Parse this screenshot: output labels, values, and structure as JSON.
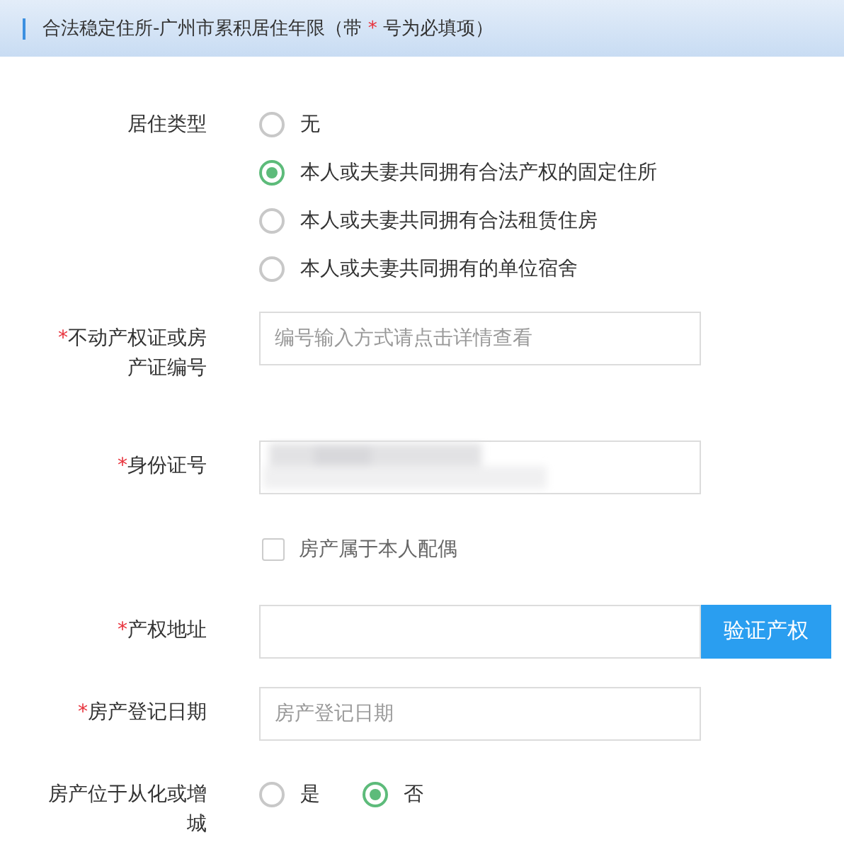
{
  "header": {
    "title_start": "合法稳定住所-广州市累积居住年限（带 ",
    "title_mark": "*",
    "title_end": " 号为必填项）"
  },
  "rows": [
    {
      "kind": "radio_group",
      "label": {
        "text": "居住类型"
      },
      "options": [
        {
          "label": "无",
          "selected": false
        },
        {
          "label": "本人或夫妻共同拥有合法产权的固定住所",
          "selected": true
        },
        {
          "label": "本人或夫妻共同拥有合法租赁住房",
          "selected": false
        },
        {
          "label": "本人或夫妻共同拥有的单位宿舍",
          "selected": false
        }
      ]
    },
    {
      "kind": "text_input",
      "label": {
        "mark": "*",
        "text": "不动产权证或房产证编号"
      },
      "placeholder": "编号输入方式请点击详情查看"
    },
    {
      "kind": "redacted_input",
      "label": {
        "mark": "*",
        "text": "身份证号"
      }
    },
    {
      "kind": "checkbox",
      "checkbox": {
        "label": "房产属于本人配偶",
        "checked": false
      }
    },
    {
      "kind": "input_with_button",
      "label": {
        "mark": "*",
        "text": "产权地址"
      },
      "button": "验证产权"
    },
    {
      "kind": "text_input",
      "label": {
        "mark": "*",
        "text": "房产登记日期"
      },
      "placeholder": "房产登记日期"
    },
    {
      "kind": "radio_inline",
      "label": {
        "text": "房产位于从化或增城"
      },
      "options": [
        {
          "label": "是",
          "selected": false
        },
        {
          "label": "否",
          "selected": true
        }
      ]
    }
  ]
}
